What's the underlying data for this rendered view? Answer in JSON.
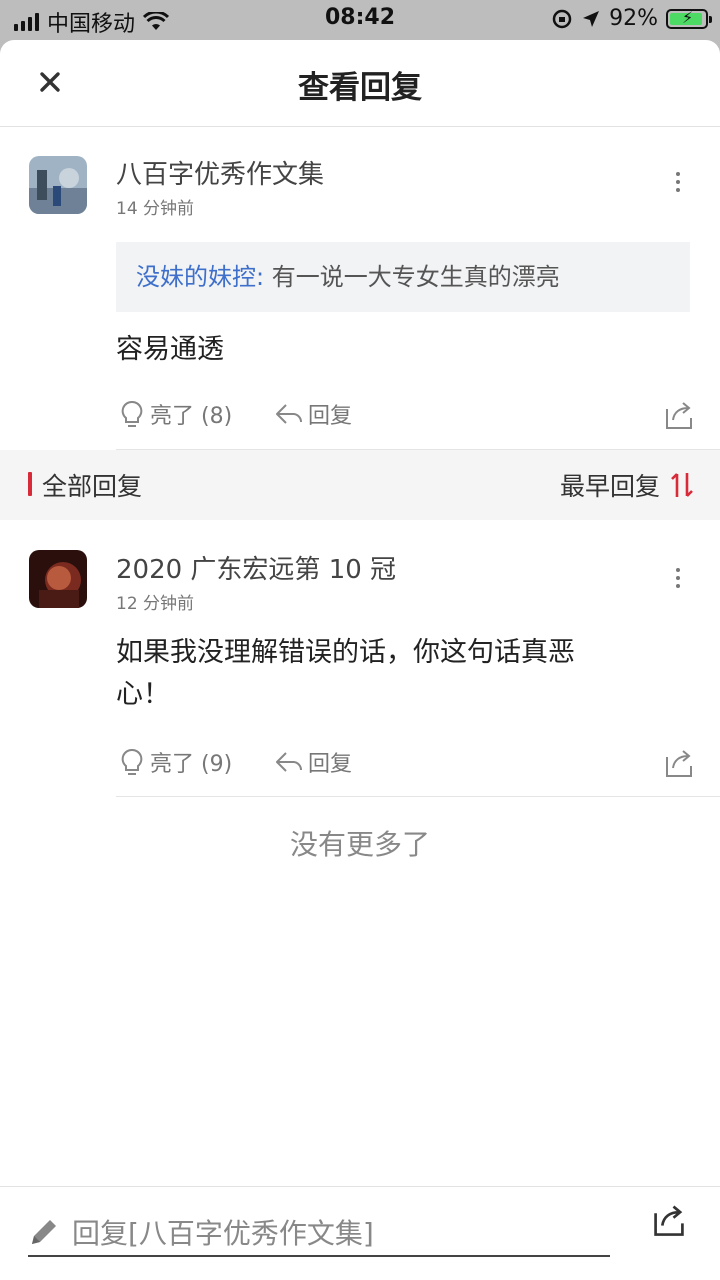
{
  "status_bar": {
    "carrier": "中国移动",
    "time": "08:42",
    "battery_percent": "92%"
  },
  "header": {
    "title": "查看回复",
    "close_icon": "close-icon"
  },
  "original_comment": {
    "user_name": "八百字优秀作文集",
    "time": "14 分钟前",
    "quote": {
      "user": "没妹的妹控:",
      "text": "有一说一大专女生真的漂亮"
    },
    "content": "容易通透",
    "like_label": "亮了 (8)",
    "reply_label": "回复"
  },
  "section": {
    "title": "全部回复",
    "sort_label": "最早回复",
    "accent_color": "#d72b3a"
  },
  "replies": [
    {
      "user_name": "2020 广东宏远第 10 冠",
      "time": "12 分钟前",
      "content_line1": "如果我没理解错误的话，你这句话真恶",
      "content_line2": "心！",
      "like_label": "亮了 (9)",
      "reply_label": "回复"
    }
  ],
  "footer_text": "没有更多了",
  "bottom_bar": {
    "placeholder": "回复[八百字优秀作文集]",
    "icons": [
      "pencil-icon",
      "share-icon"
    ]
  }
}
